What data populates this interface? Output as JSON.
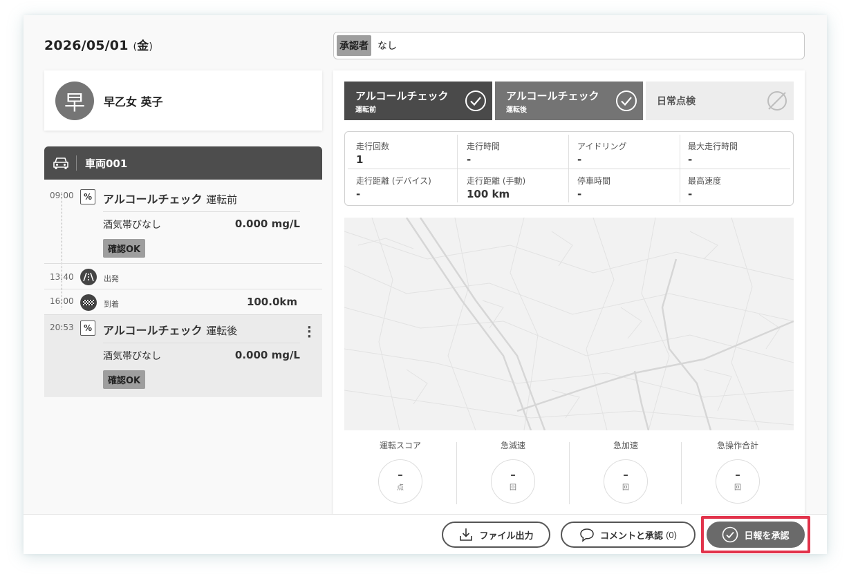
{
  "header": {
    "date_ymd": "2026/05/01",
    "paren_open": "(",
    "day_of_week": "金",
    "paren_close": ")",
    "approver_label": "承認者",
    "approver_value": "なし"
  },
  "driver": {
    "avatar_char": "早",
    "name": "早乙女 英子"
  },
  "vehicle": {
    "name": "車両001"
  },
  "timeline": {
    "check1": {
      "time": "09:00",
      "title": "アルコールチェック",
      "subtitle": "運転前",
      "result_label": "酒気帯びなし",
      "result_value": "0.000 mg/L",
      "badge": "確認OK"
    },
    "depart": {
      "time": "13:40",
      "label": "出発"
    },
    "arrive": {
      "time": "16:00",
      "label": "到着",
      "distance": "100.0km"
    },
    "check2": {
      "time": "20:53",
      "title": "アルコールチェック",
      "subtitle": "運転後",
      "result_label": "酒気帯びなし",
      "result_value": "0.000 mg/L",
      "badge": "確認OK"
    }
  },
  "check_tabs": [
    {
      "title": "アルコールチェック",
      "sub": "運転前",
      "status": "check-circle-icon"
    },
    {
      "title": "アルコールチェック",
      "sub": "運転後",
      "status": "check-circle-icon"
    },
    {
      "title": "日常点検",
      "sub": "",
      "status": "not-done-icon"
    }
  ],
  "stats": [
    {
      "label": "走行回数",
      "value": "1"
    },
    {
      "label": "走行時間",
      "value": "-"
    },
    {
      "label": "アイドリング",
      "value": "-"
    },
    {
      "label": "最大走行時間",
      "value": "-"
    },
    {
      "label": "走行距離 (デバイス)",
      "value": "-"
    },
    {
      "label": "走行距離 (手動)",
      "value": "100 km"
    },
    {
      "label": "停車時間",
      "value": "-"
    },
    {
      "label": "最高速度",
      "value": "-"
    }
  ],
  "scores": [
    {
      "label": "運転スコア",
      "value": "–",
      "unit": "点"
    },
    {
      "label": "急減速",
      "value": "–",
      "unit": "回"
    },
    {
      "label": "急加速",
      "value": "–",
      "unit": "回"
    },
    {
      "label": "急操作合計",
      "value": "–",
      "unit": "回"
    }
  ],
  "footer": {
    "export_label": "ファイル出力",
    "comment_label": "コメントと承認",
    "comment_count": "(0)",
    "approve_label": "日報を承認"
  },
  "colors": {
    "tab_active_dark": "#4a4a4a",
    "tab_active_mid": "#747474",
    "tab_inactive": "#ededed",
    "approve_button": "#6a6a6a",
    "highlight_outline": "#e2334b"
  }
}
